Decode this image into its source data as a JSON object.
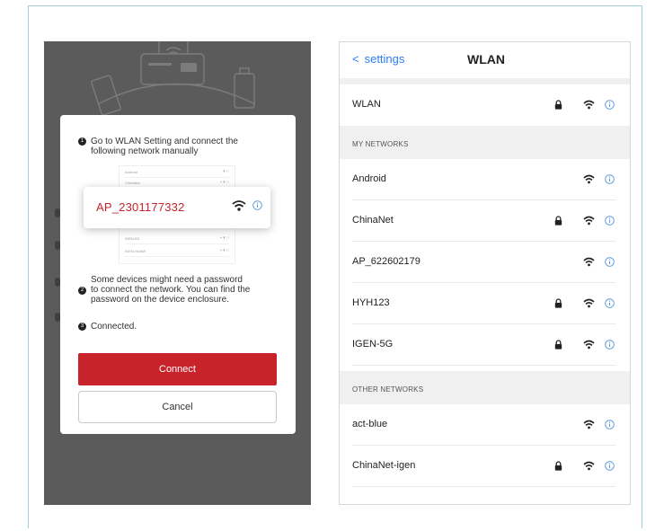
{
  "dialog": {
    "steps": [
      {
        "number": "1",
        "lines": [
          "Go to WLAN Setting and connect the",
          "following network manually"
        ]
      },
      {
        "number": "2",
        "lines": [
          "Some devices might need a password",
          "to connect the network. You can find the",
          "password on the device enclosure."
        ]
      },
      {
        "number": "3",
        "lines": [
          "Connected."
        ]
      }
    ],
    "highlighted_network": "AP_2301177332",
    "connect_label": "Connect",
    "cancel_label": "Cancel"
  },
  "wlan": {
    "back_label": "settings",
    "title": "WLAN",
    "wlan_row_label": "WLAN",
    "my_networks_header": "MY NETWORKS",
    "my_networks": [
      {
        "name": "Android",
        "locked": false
      },
      {
        "name": "ChinaNet",
        "locked": true
      },
      {
        "name": "AP_622602179",
        "locked": false
      },
      {
        "name": "HYH123",
        "locked": true
      },
      {
        "name": "IGEN-5G",
        "locked": true
      }
    ],
    "other_networks_header": "OTHER  NETWORKS",
    "other_networks": [
      {
        "name": "act-blue",
        "locked": false
      },
      {
        "name": "ChinaNet-igen",
        "locked": true
      }
    ]
  },
  "colors": {
    "accent_red": "#c8232b",
    "link_blue": "#2d7cf6",
    "info_blue": "#4a90d9"
  },
  "icons": {
    "lock": "lock-icon",
    "wifi": "wifi-icon",
    "info": "info-icon",
    "back": "chevron-left-icon"
  }
}
